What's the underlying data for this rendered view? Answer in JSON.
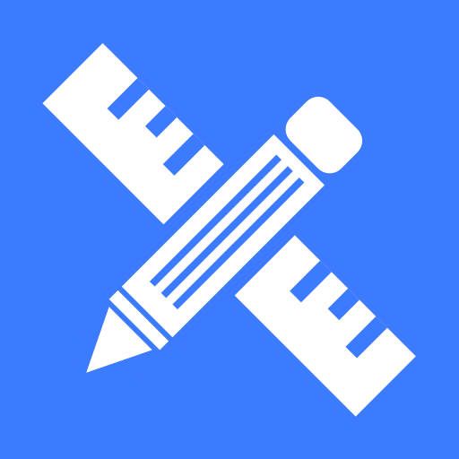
{
  "icon": {
    "name": "pencil-ruler-icon",
    "background_color": "#3d7bfe",
    "foreground_color": "#ffffff"
  }
}
